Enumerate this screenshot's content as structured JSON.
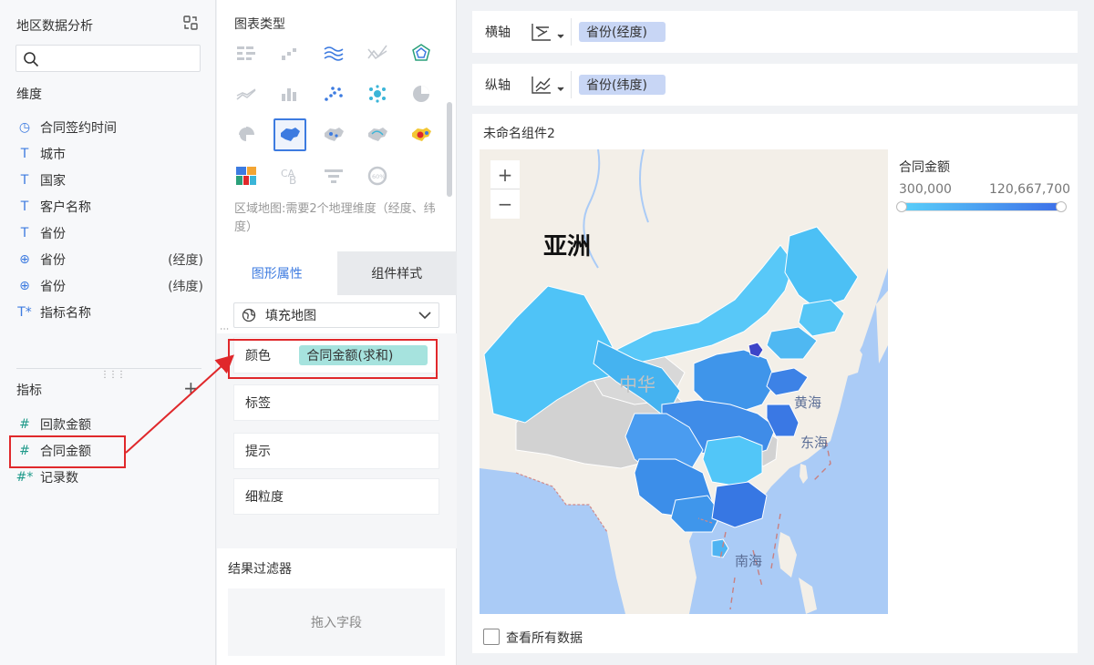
{
  "left": {
    "title": "地区数据分析",
    "dimension_title": "维度",
    "dimensions": [
      {
        "icon": "clock-icon",
        "glyph": "◷",
        "label": "合同签约时间",
        "suffix": ""
      },
      {
        "icon": "text-type-icon",
        "glyph": "T",
        "label": "城市",
        "suffix": ""
      },
      {
        "icon": "text-type-icon",
        "glyph": "T",
        "label": "国家",
        "suffix": ""
      },
      {
        "icon": "text-type-icon",
        "glyph": "T",
        "label": "客户名称",
        "suffix": ""
      },
      {
        "icon": "text-type-icon",
        "glyph": "T",
        "label": "省份",
        "suffix": ""
      },
      {
        "icon": "globe-icon",
        "glyph": "⊕",
        "label": "省份",
        "suffix": "(经度)"
      },
      {
        "icon": "globe-icon",
        "glyph": "⊕",
        "label": "省份",
        "suffix": "(纬度)"
      },
      {
        "icon": "text-type-icon",
        "glyph": "T*",
        "label": "指标名称",
        "suffix": ""
      }
    ],
    "measure_title": "指标",
    "plus": "+",
    "measures": [
      {
        "icon": "hash-icon",
        "glyph": "#",
        "label": "回款金额"
      },
      {
        "icon": "hash-icon",
        "glyph": "#",
        "label": "合同金额"
      },
      {
        "icon": "hash-icon",
        "glyph": "#*",
        "label": "记录数"
      }
    ]
  },
  "mid": {
    "chart_type_title": "图表类型",
    "chart_type_hint": "区域地图:需要2个地理维度（经度、纬度）",
    "tabs": [
      "图形属性",
      "组件样式"
    ],
    "map_type": "填充地图",
    "color_label": "颜色",
    "color_field": "合同金额(求和)",
    "props": [
      "标签",
      "提示",
      "细粒度"
    ],
    "filter_title": "结果过滤器",
    "filter_drop": "拖入字段"
  },
  "axes": {
    "x_label": "横轴",
    "x_field": "省份(经度)",
    "y_label": "纵轴",
    "y_field": "省份(纬度)"
  },
  "card": {
    "title": "未命名组件2",
    "map_labels": {
      "continent": "亚洲",
      "zhonghua": "中华",
      "yellow_sea": "黄海",
      "east_sea": "东海",
      "south_sea": "南海"
    },
    "zoom_in": "+",
    "zoom_out": "−",
    "legend_title": "合同金额",
    "legend_min": "300,000",
    "legend_max": "120,667,700",
    "show_all": "查看所有数据"
  },
  "colors": {
    "accent": "#3d7be0",
    "red_highlight": "#e0282b",
    "teal_pill": "#a6e3de",
    "blue_pill": "#c8d6f5",
    "sea": "#aacbf6",
    "land": "#f3efe8",
    "low": "#5ad1fa",
    "high": "#3d6ee8"
  }
}
